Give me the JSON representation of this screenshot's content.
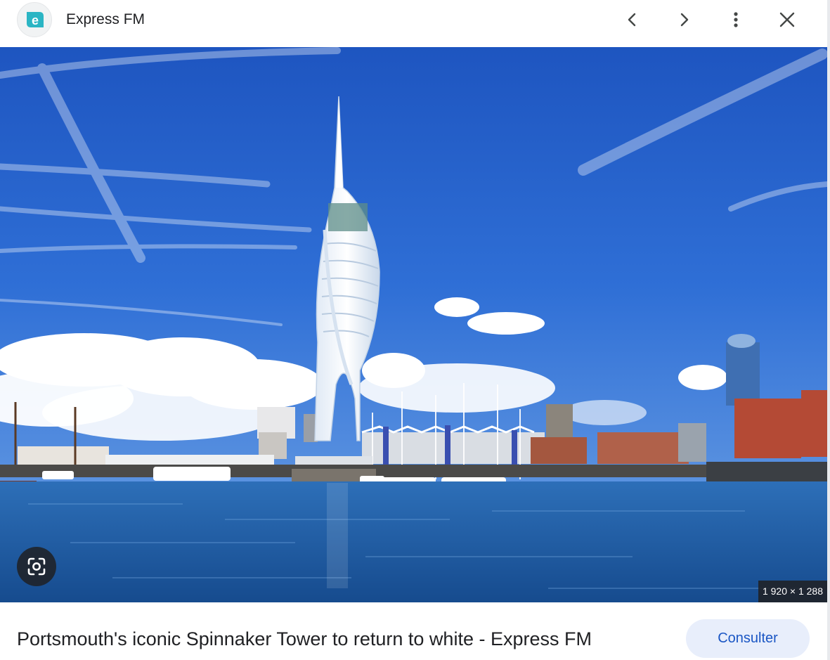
{
  "header": {
    "site_name": "Express FM",
    "logo_icon": "express-fm-logo",
    "logo_letter": "e",
    "prev_icon": "chevron-left-icon",
    "next_icon": "chevron-right-icon",
    "more_icon": "more-vert-icon",
    "close_icon": "close-icon"
  },
  "image": {
    "subject": "Spinnaker Tower, Portsmouth harbour",
    "dimensions": "1 920 × 1 288",
    "lens_icon": "google-lens-icon"
  },
  "footer": {
    "title": "Portsmouth's iconic Spinnaker Tower to return to white - Express FM",
    "visit_label": "Consulter"
  },
  "colors": {
    "accent": "#1a56c4",
    "visit_bg": "#e8eefb",
    "logo_teal": "#2bb5c4",
    "sky": "#2a63c9",
    "water": "#1f5aa3"
  }
}
